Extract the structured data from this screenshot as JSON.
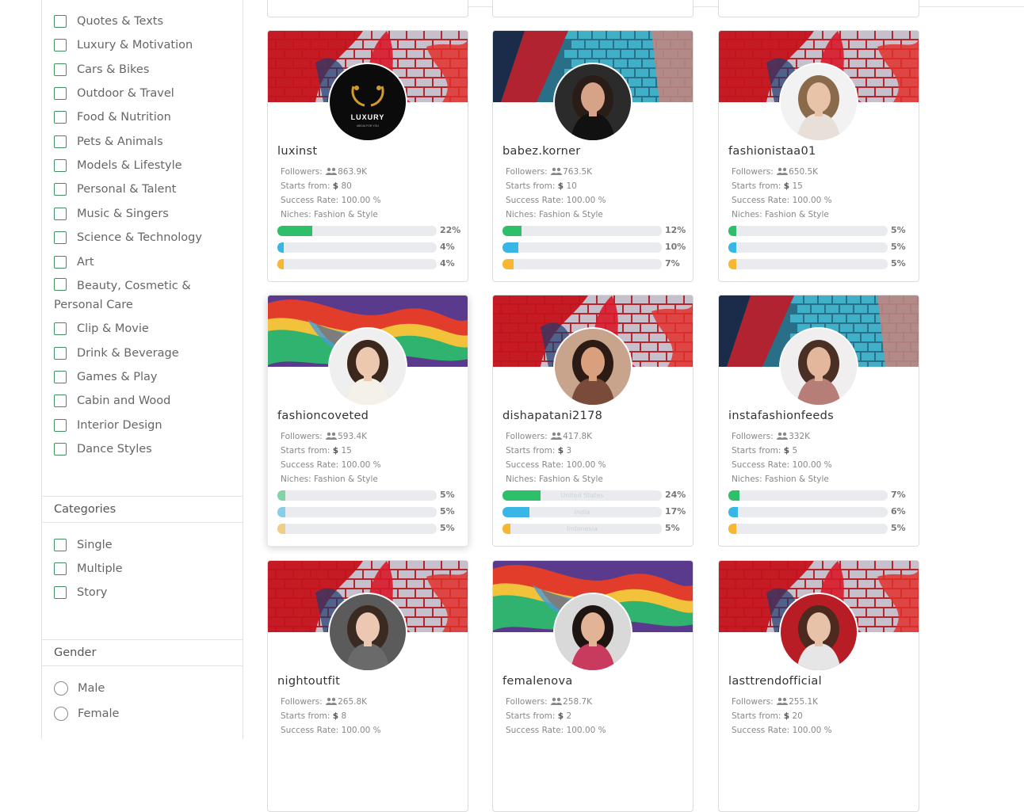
{
  "filters": {
    "niches": [
      "Quotes & Texts",
      "Luxury & Motivation",
      "Cars & Bikes",
      "Outdoor & Travel",
      "Food & Nutrition",
      "Pets & Animals",
      "Models & Lifestyle",
      "Personal & Talent",
      "Music & Singers",
      "Science & Technology",
      "Art",
      "Beauty, Cosmetic & Personal Care",
      "Clip & Movie",
      "Drink & Beverage",
      "Games & Play",
      "Cabin and Wood",
      "Interior Design",
      "Dance Styles"
    ],
    "categories_title": "Categories",
    "categories": [
      "Single",
      "Multiple",
      "Story"
    ],
    "gender_title": "Gender",
    "genders": [
      "Male",
      "Female"
    ]
  },
  "labels": {
    "followers": "Followers:",
    "starts_from": "Starts from:",
    "currency": "$",
    "success_rate": "Success Rate:",
    "niches": "Niches:"
  },
  "colors": {
    "bar_green": "#2ebf6a",
    "bar_blue": "#38b6e6",
    "bar_yellow": "#f7b731",
    "checkbox_border": "#3f8f5f"
  },
  "cards": [
    {
      "username": "luxinst",
      "followers": "863.9K",
      "starts_from": "80",
      "success_rate": "100.00 %",
      "niches": "Fashion & Style",
      "bars": [
        {
          "pct": "22%",
          "value": 0.22
        },
        {
          "pct": "4%",
          "value": 0.04
        },
        {
          "pct": "4%",
          "value": 0.04
        }
      ],
      "avatar_logo": "LUXURY",
      "avatar_sub": "MEDIA FOR YOU"
    },
    {
      "username": "babez.korner",
      "followers": "763.5K",
      "starts_from": "10",
      "success_rate": "100.00 %",
      "niches": "Fashion & Style",
      "bars": [
        {
          "pct": "12%",
          "value": 0.12
        },
        {
          "pct": "10%",
          "value": 0.1
        },
        {
          "pct": "7%",
          "value": 0.07
        }
      ]
    },
    {
      "username": "fashionistaa01",
      "followers": "650.5K",
      "starts_from": "15",
      "success_rate": "100.00 %",
      "niches": "Fashion & Style",
      "bars": [
        {
          "pct": "5%",
          "value": 0.05
        },
        {
          "pct": "5%",
          "value": 0.05
        },
        {
          "pct": "5%",
          "value": 0.05
        }
      ]
    },
    {
      "username": "fashioncoveted",
      "followers": "593.4K",
      "starts_from": "15",
      "success_rate": "100.00 %",
      "niches": "Fashion & Style",
      "bars": [
        {
          "pct": "5%",
          "value": 0.05
        },
        {
          "pct": "5%",
          "value": 0.05
        },
        {
          "pct": "5%",
          "value": 0.05
        }
      ]
    },
    {
      "username": "dishapatani2178",
      "followers": "417.8K",
      "starts_from": "3",
      "success_rate": "100.00 %",
      "niches": "Fashion & Style",
      "bars": [
        {
          "pct": "24%",
          "value": 0.24,
          "country": "United States"
        },
        {
          "pct": "17%",
          "value": 0.17,
          "country": "India"
        },
        {
          "pct": "5%",
          "value": 0.05,
          "country": "Indonesia"
        }
      ]
    },
    {
      "username": "instafashionfeeds",
      "followers": "332K",
      "starts_from": "5",
      "success_rate": "100.00 %",
      "niches": "Fashion & Style",
      "bars": [
        {
          "pct": "7%",
          "value": 0.07
        },
        {
          "pct": "6%",
          "value": 0.06
        },
        {
          "pct": "5%",
          "value": 0.05
        }
      ]
    },
    {
      "username": "nightoutfit",
      "followers": "265.8K",
      "starts_from": "8",
      "success_rate": "100.00 %"
    },
    {
      "username": "femalenova",
      "followers": "258.7K",
      "starts_from": "2",
      "success_rate": "100.00 %"
    },
    {
      "username": "lasttrendofficial",
      "followers": "255.1K",
      "starts_from": "20",
      "success_rate": "100.00 %"
    }
  ]
}
